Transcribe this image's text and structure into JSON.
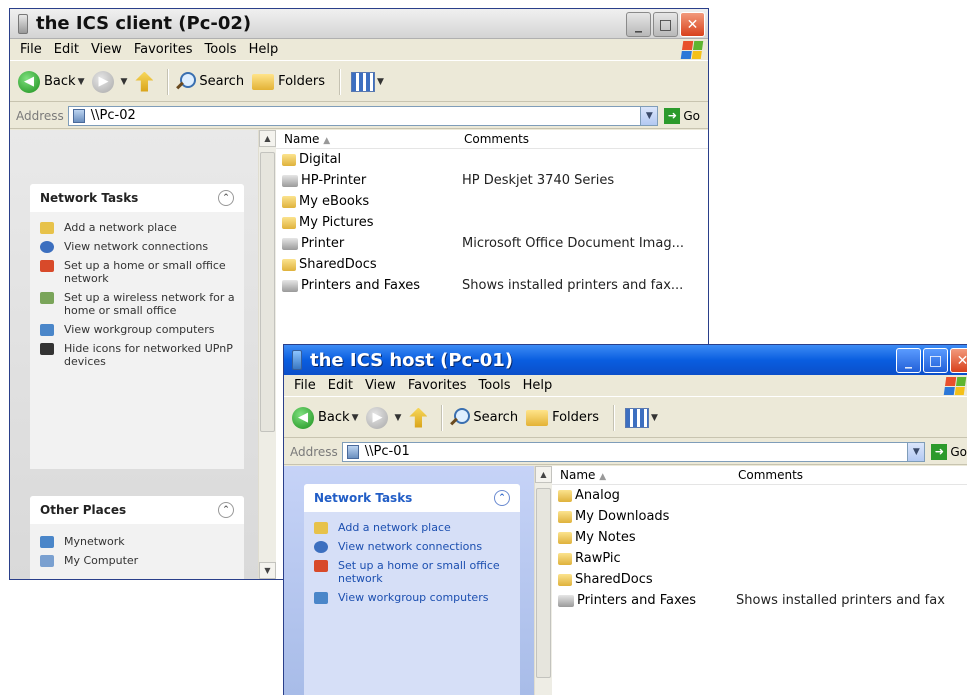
{
  "client": {
    "title": "the ICS client (Pc-02)",
    "menu": [
      "File",
      "Edit",
      "View",
      "Favorites",
      "Tools",
      "Help"
    ],
    "toolbar": {
      "back": "Back",
      "search": "Search",
      "folders": "Folders"
    },
    "address": {
      "label": "Address",
      "value": "\\\\Pc-02",
      "go": "Go"
    },
    "network_tasks": {
      "title": "Network Tasks",
      "items": [
        "Add a network place",
        "View network connections",
        "Set up a home or small office network",
        "Set up a wireless network for a home or small office",
        "View workgroup computers",
        "Hide icons for networked UPnP devices"
      ]
    },
    "other_places": {
      "title": "Other Places",
      "items": [
        "Mynetwork",
        "My Computer"
      ]
    },
    "columns": {
      "name": "Name",
      "comments": "Comments"
    },
    "files": [
      {
        "name": "Digital",
        "comment": "",
        "type": "share"
      },
      {
        "name": "HP-Printer",
        "comment": "HP Deskjet 3740 Series",
        "type": "printer"
      },
      {
        "name": "My eBooks",
        "comment": "",
        "type": "share"
      },
      {
        "name": "My Pictures",
        "comment": "",
        "type": "share"
      },
      {
        "name": "Printer",
        "comment": "Microsoft Office Document Imag...",
        "type": "printer"
      },
      {
        "name": "SharedDocs",
        "comment": "",
        "type": "share"
      },
      {
        "name": "Printers and Faxes",
        "comment": "Shows installed printers and fax...",
        "type": "printers"
      }
    ]
  },
  "host": {
    "title": "the ICS host (Pc-01)",
    "menu": [
      "File",
      "Edit",
      "View",
      "Favorites",
      "Tools",
      "Help"
    ],
    "toolbar": {
      "back": "Back",
      "search": "Search",
      "folders": "Folders"
    },
    "address": {
      "label": "Address",
      "value": "\\\\Pc-01",
      "go": "Go"
    },
    "network_tasks": {
      "title": "Network Tasks",
      "items": [
        "Add a network place",
        "View network connections",
        "Set up a home or small office network",
        "View workgroup computers"
      ]
    },
    "columns": {
      "name": "Name",
      "comments": "Comments"
    },
    "files": [
      {
        "name": "Analog",
        "comment": "",
        "type": "share"
      },
      {
        "name": "My Downloads",
        "comment": "",
        "type": "share"
      },
      {
        "name": "My Notes",
        "comment": "",
        "type": "share"
      },
      {
        "name": "RawPic",
        "comment": "",
        "type": "share"
      },
      {
        "name": "SharedDocs",
        "comment": "",
        "type": "share"
      },
      {
        "name": "Printers and Faxes",
        "comment": "Shows installed printers and fax",
        "type": "printers"
      }
    ]
  },
  "icons": [
    "xp-logo-icon",
    "back-icon",
    "forward-icon",
    "up-folder-icon",
    "search-icon",
    "folders-icon",
    "views-icon",
    "network-drive-icon",
    "go-icon",
    "chevron-up-icon",
    "shared-folder-icon",
    "printer-icon"
  ]
}
